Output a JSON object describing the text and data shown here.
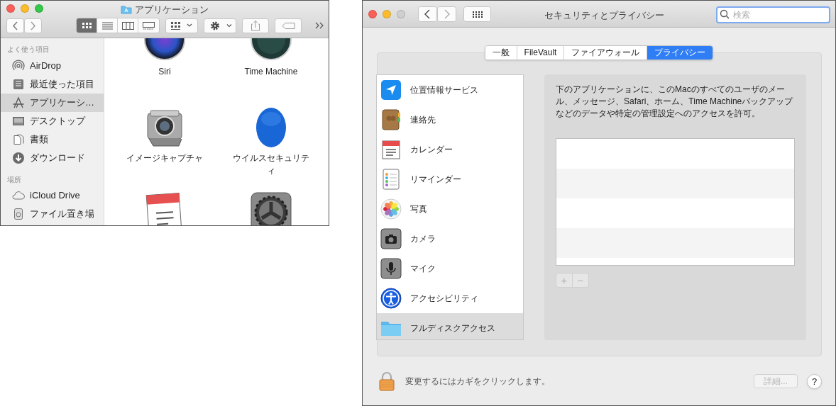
{
  "finder": {
    "title": "アプリケーション",
    "view_modes": [
      {
        "selected": true
      },
      {
        "selected": false
      },
      {
        "selected": false
      },
      {
        "selected": false
      }
    ],
    "sidebar": [
      {
        "heading": "よく使う項目",
        "items": [
          {
            "label": "AirDrop",
            "selected": false
          },
          {
            "label": "最近使った項目",
            "selected": false
          },
          {
            "label": "アプリケーシ…",
            "selected": true
          },
          {
            "label": "デスクトップ",
            "selected": false
          },
          {
            "label": "書類",
            "selected": false
          },
          {
            "label": "ダウンロード",
            "selected": false
          }
        ]
      },
      {
        "heading": "場所",
        "items": [
          {
            "label": "iCloud Drive",
            "selected": false
          },
          {
            "label": "ファイル置き場",
            "selected": false
          }
        ]
      }
    ],
    "apps": [
      {
        "label": "Siri"
      },
      {
        "label": "Time Machine"
      },
      {
        "label": "イメージキャプチャ"
      },
      {
        "label": "ウイルスセキュリティ"
      }
    ]
  },
  "prefs": {
    "title": "セキュリティとプライバシー",
    "search": {
      "placeholder": "検索"
    },
    "tabs": [
      {
        "label": "一般",
        "selected": false
      },
      {
        "label": "FileVault",
        "selected": false
      },
      {
        "label": "ファイアウォール",
        "selected": false
      },
      {
        "label": "プライバシー",
        "selected": true
      }
    ],
    "categories": [
      {
        "label": "位置情報サービス",
        "selected": false
      },
      {
        "label": "連絡先",
        "selected": false
      },
      {
        "label": "カレンダー",
        "selected": false
      },
      {
        "label": "リマインダー",
        "selected": false
      },
      {
        "label": "写真",
        "selected": false
      },
      {
        "label": "カメラ",
        "selected": false
      },
      {
        "label": "マイク",
        "selected": false
      },
      {
        "label": "アクセシビリティ",
        "selected": false
      },
      {
        "label": "フルディスクアクセス",
        "selected": true
      }
    ],
    "description": "下のアプリケーションに、このMacのすべてのユーザのメール、メッセージ、Safari、ホーム、Time Machineバックアップなどのデータや特定の管理設定へのアクセスを許可。",
    "list_buttons": [
      {
        "label": "+",
        "disabled": true
      },
      {
        "label": "−",
        "disabled": true
      }
    ],
    "lock_message": "変更するにはカギをクリックします。",
    "advanced_button": {
      "label": "詳細...",
      "disabled": true
    },
    "help_button": "?"
  }
}
